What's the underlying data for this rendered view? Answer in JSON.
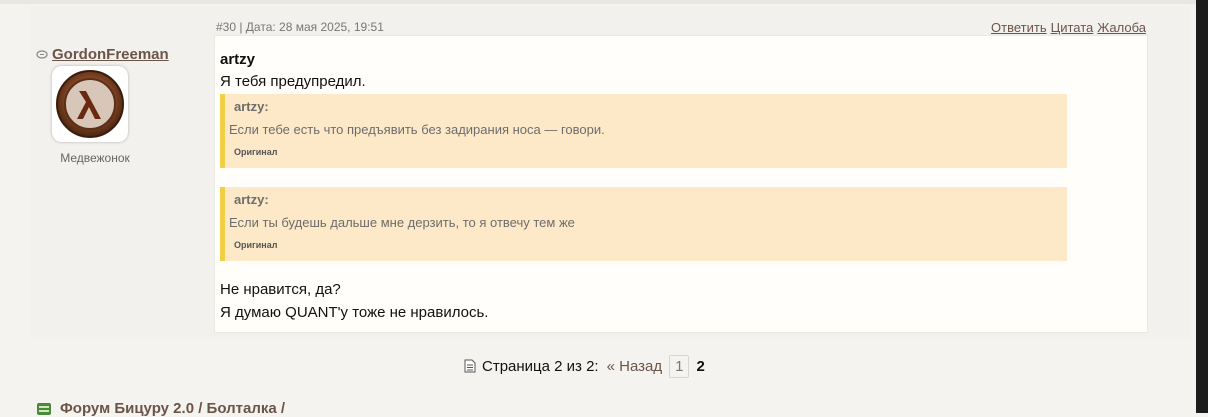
{
  "post": {
    "meta": "#30 | Дата: 28 мая 2025, 19:51",
    "actions": {
      "reply": "Ответить",
      "quote": "Цитата",
      "report": "Жалоба"
    },
    "user": {
      "name": "GordonFreeman",
      "rank": "Медвежонок",
      "avatar_icon": "half-life-lambda-icon"
    },
    "author": "artzy",
    "line1": "Я тебя предупредил.",
    "quotes": [
      {
        "author": "artzy:",
        "text": "Если тебе есть что предъявить без задирания носа — говори.",
        "original": "Оригинал"
      },
      {
        "author": "artzy:",
        "text": "Если ты будешь дальше мне дерзить, то я отвечу тем же",
        "original": "Оригинал"
      }
    ],
    "line2": "Не нравится, да?",
    "line3": "Я думаю QUANT'у тоже не нравилось."
  },
  "pager": {
    "label": "Страница 2 из 2:",
    "back": "« Назад",
    "pages": [
      "1",
      "2"
    ],
    "current": "2"
  },
  "footer": {
    "forum_path": "Форум Бицуру 2.0 / Болталка /"
  },
  "colors": {
    "accent": "#6b5548",
    "quote_bg": "#fde9c8",
    "quote_border": "#f2cf45"
  }
}
